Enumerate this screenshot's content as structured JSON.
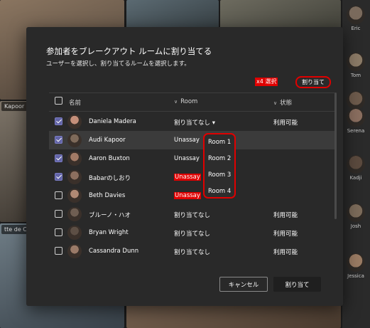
{
  "background": {
    "tile_labels": {
      "left_a": "Kapoor",
      "left_b": "tte de Cr"
    },
    "rail": [
      {
        "name": "Eric",
        "color": "#7a6a5c"
      },
      {
        "name": "Tom",
        "color": "#8b7a66"
      },
      {
        "name": "",
        "color": "#6e5b4c"
      },
      {
        "name": "Serena",
        "color": "#8a6e5f"
      },
      {
        "name": "Kadji",
        "color": "#5b4a3e"
      },
      {
        "name": "Josh",
        "color": "#7c6b5a"
      },
      {
        "name": "Jessica",
        "color": "#9a7b63"
      }
    ]
  },
  "dialog": {
    "title": "参加者をブレークアウト ルームに割り当てる",
    "subtitle": "ユーザーを選択し、割り当てるルームを選択します。",
    "selected_count": "x4 選択",
    "assign_top_label": "割り当て",
    "columns": {
      "name": "名前",
      "room": "Room",
      "status": "状態"
    },
    "rows": [
      {
        "name": "Daniela Madera",
        "room": "割り当てなし ▾",
        "status": "利用可能",
        "checked": true,
        "highlight": false,
        "room_red": false,
        "avatar": "#c48f7a"
      },
      {
        "name": "Audi Kapoor",
        "room": "Unassay",
        "status": "",
        "checked": true,
        "highlight": true,
        "room_red": false,
        "avatar": "#7e6a5a"
      },
      {
        "name": "Aaron Buxton",
        "room": "Unassay",
        "status": "",
        "checked": true,
        "highlight": false,
        "room_red": false,
        "avatar": "#a27a66"
      },
      {
        "name": "Babarのしおり",
        "room": "Unassay",
        "status": "",
        "checked": true,
        "highlight": false,
        "room_red": true,
        "avatar": "#8c6f5f"
      },
      {
        "name": "Beth Davies",
        "room": "Unassay",
        "status": "",
        "checked": false,
        "highlight": false,
        "room_red": true,
        "avatar": "#b08974"
      },
      {
        "name": "ブルーノ・ハオ",
        "room": "割り当てなし",
        "status": "利用可能",
        "checked": false,
        "highlight": false,
        "room_red": false,
        "avatar": "#6f5e52"
      },
      {
        "name": "Bryan Wright",
        "room": "割り当てなし",
        "status": "利用可能",
        "checked": false,
        "highlight": false,
        "room_red": false,
        "avatar": "#5d4f45"
      },
      {
        "name": "Cassandra Dunn",
        "room": "割り当てなし",
        "status": "利用可能",
        "checked": false,
        "highlight": false,
        "room_red": false,
        "avatar": "#9a7a68"
      }
    ],
    "room_options": [
      "Room 1",
      "Room 2",
      "Room 3",
      "Room 4"
    ],
    "cancel_label": "キャンセル",
    "assign_label": "割り当て",
    "accent_color": "#e00000",
    "checkbox_color": "#6264a7"
  }
}
